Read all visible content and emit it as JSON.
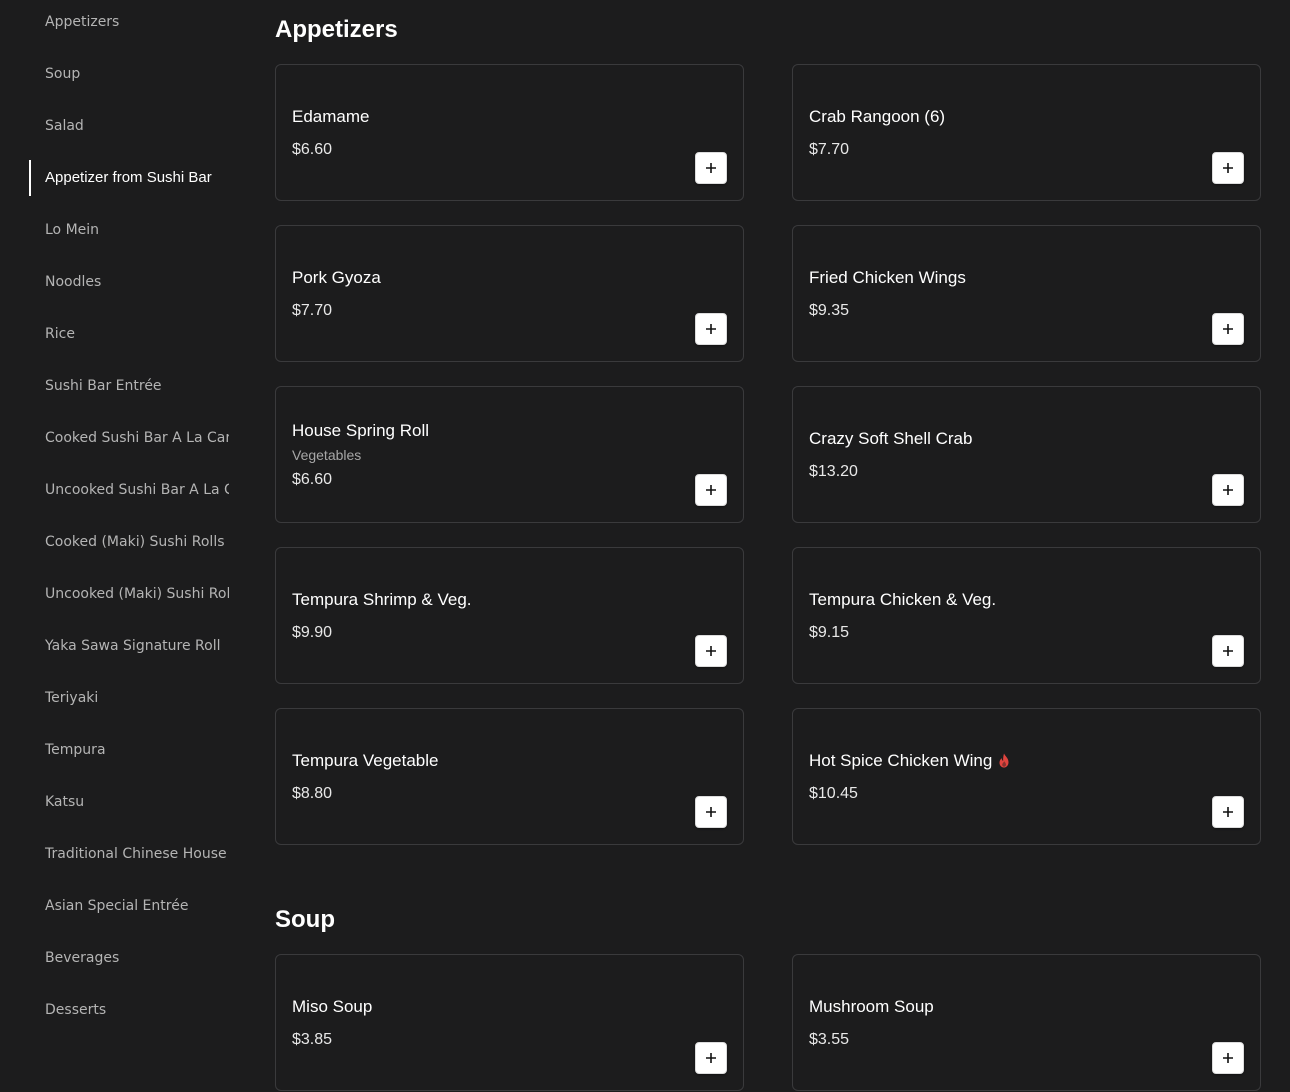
{
  "sidebar": {
    "items": [
      {
        "label": "Appetizers"
      },
      {
        "label": "Soup"
      },
      {
        "label": "Salad"
      },
      {
        "label": "Appetizer from Sushi Bar"
      },
      {
        "label": "Lo Mein"
      },
      {
        "label": "Noodles"
      },
      {
        "label": "Rice"
      },
      {
        "label": "Sushi Bar Entrée"
      },
      {
        "label": "Cooked Sushi Bar A La Carte"
      },
      {
        "label": "Uncooked Sushi Bar A La Carte"
      },
      {
        "label": "Cooked (Maki) Sushi Rolls"
      },
      {
        "label": "Uncooked (Maki) Sushi Rolls"
      },
      {
        "label": "Yaka Sawa Signature Roll"
      },
      {
        "label": "Teriyaki"
      },
      {
        "label": "Tempura"
      },
      {
        "label": "Katsu"
      },
      {
        "label": "Traditional Chinese House"
      },
      {
        "label": "Asian Special Entrée"
      },
      {
        "label": "Beverages"
      },
      {
        "label": "Desserts"
      }
    ],
    "active_label": "Appetizer from Sushi Bar"
  },
  "sections": [
    {
      "title": "Appetizers",
      "items": [
        {
          "name": "Edamame",
          "price": "$6.60"
        },
        {
          "name": "Crab Rangoon (6)",
          "price": "$7.70"
        },
        {
          "name": "Pork Gyoza",
          "price": "$7.70"
        },
        {
          "name": "Fried Chicken Wings",
          "price": "$9.35"
        },
        {
          "name": "House Spring Roll",
          "description": "Vegetables",
          "price": "$6.60"
        },
        {
          "name": "Crazy Soft Shell Crab",
          "price": "$13.20"
        },
        {
          "name": "Tempura Shrimp & Veg.",
          "price": "$9.90"
        },
        {
          "name": "Tempura Chicken & Veg.",
          "price": "$9.15"
        },
        {
          "name": "Tempura Vegetable",
          "price": "$8.80"
        },
        {
          "name": "Hot Spice Chicken Wing",
          "price": "$10.45",
          "icon": "spicy-flame-icon"
        }
      ]
    },
    {
      "title": "Soup",
      "items": [
        {
          "name": "Miso Soup",
          "price": "$3.85"
        },
        {
          "name": "Mushroom Soup",
          "price": "$3.55"
        }
      ]
    }
  ],
  "colors": {
    "background": "#1c1c1d",
    "card_border": "#3a3a3c",
    "spicy": "#e0443e",
    "add_button": "#ffffff"
  },
  "icons": {
    "add": "plus-icon",
    "spicy": "flame-icon"
  }
}
